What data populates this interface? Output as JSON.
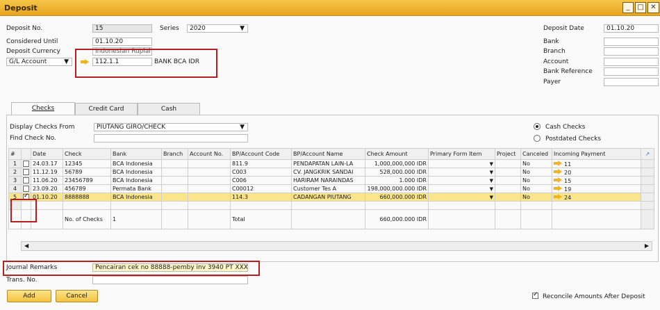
{
  "window": {
    "title": "Deposit"
  },
  "header": {
    "deposit_no_label": "Deposit No.",
    "deposit_no_value": "15",
    "series_label": "Series",
    "series_value": "2020",
    "considered_until_label": "Considered Until",
    "considered_until_value": "01.10.20",
    "deposit_currency_label": "Deposit Currency",
    "deposit_currency_value": "Indonesian Rupiah",
    "gl_account_label": "G/L Account",
    "gl_account_value": "112.1.1",
    "gl_account_name": "BANK BCA IDR",
    "deposit_date_label": "Deposit Date",
    "deposit_date_value": "01.10.20",
    "bank_label": "Bank",
    "branch_label": "Branch",
    "account_label": "Account",
    "bank_reference_label": "Bank Reference",
    "payer_label": "Payer"
  },
  "tabs": [
    {
      "label": "Checks"
    },
    {
      "label": "Credit Card"
    },
    {
      "label": "Cash"
    }
  ],
  "checks": {
    "display_from_label": "Display Checks From",
    "display_from_value": "PIUTANG GIRO/CHECK",
    "find_check_label": "Find Check No.",
    "find_check_value": "",
    "cash_checks_label": "Cash Checks",
    "postdated_checks_label": "Postdated Checks",
    "columns": [
      "#",
      "",
      "Date",
      "Check",
      "Bank",
      "Branch",
      "Account No.",
      "BP/Account Code",
      "BP/Account Name",
      "Check Amount",
      "Primary Form Item",
      "Project",
      "Canceled",
      "Incoming Payment"
    ],
    "rows": [
      {
        "n": "1",
        "checked": false,
        "date": "24.03.17",
        "check": "12345",
        "bank": "BCA Indonesia",
        "branch": "",
        "account": "",
        "code": "811.9",
        "name": "PENDAPATAN LAIN-LA",
        "amount": "1,000,000,000 IDR",
        "form": "",
        "project": "",
        "canceled": "No",
        "payment": "11"
      },
      {
        "n": "2",
        "checked": false,
        "date": "11.12.19",
        "check": "56789",
        "bank": "BCA Indonesia",
        "branch": "",
        "account": "",
        "code": "C003",
        "name": "CV. JANGKRIK SANDAI",
        "amount": "528,000.000 IDR",
        "form": "",
        "project": "",
        "canceled": "No",
        "payment": "20"
      },
      {
        "n": "3",
        "checked": false,
        "date": "11.06.20",
        "check": "23456789",
        "bank": "BCA Indonesia",
        "branch": "",
        "account": "",
        "code": "C006",
        "name": "HARIRAM NARAINDAS",
        "amount": "1.000 IDR",
        "form": "",
        "project": "",
        "canceled": "No",
        "payment": "15"
      },
      {
        "n": "4",
        "checked": false,
        "date": "23.09.20",
        "check": "456789",
        "bank": "Permata Bank",
        "branch": "",
        "account": "",
        "code": "C00012",
        "name": "Customer Tes A",
        "amount": "198,000,000.000 IDR",
        "form": "",
        "project": "",
        "canceled": "No",
        "payment": "19"
      },
      {
        "n": "5",
        "checked": true,
        "date": "01.10.20",
        "check": "8888888",
        "bank": "BCA Indonesia",
        "branch": "",
        "account": "",
        "code": "114.3",
        "name": "CADANGAN PIUTANG",
        "amount": "660,000.000 IDR",
        "form": "",
        "project": "",
        "canceled": "No",
        "payment": "24"
      }
    ],
    "no_of_checks_label": "No. of Checks",
    "no_of_checks_value": "1",
    "total_label": "Total",
    "total_value": "660,000.000 IDR"
  },
  "footer": {
    "journal_remarks_label": "Journal Remarks",
    "journal_remarks_value": "Pencairan cek no 88888-pemby inv 3940 PT XXX",
    "trans_no_label": "Trans. No.",
    "reconcile_label": "Reconcile Amounts After Deposit",
    "add_label": "Add",
    "cancel_label": "Cancel"
  }
}
